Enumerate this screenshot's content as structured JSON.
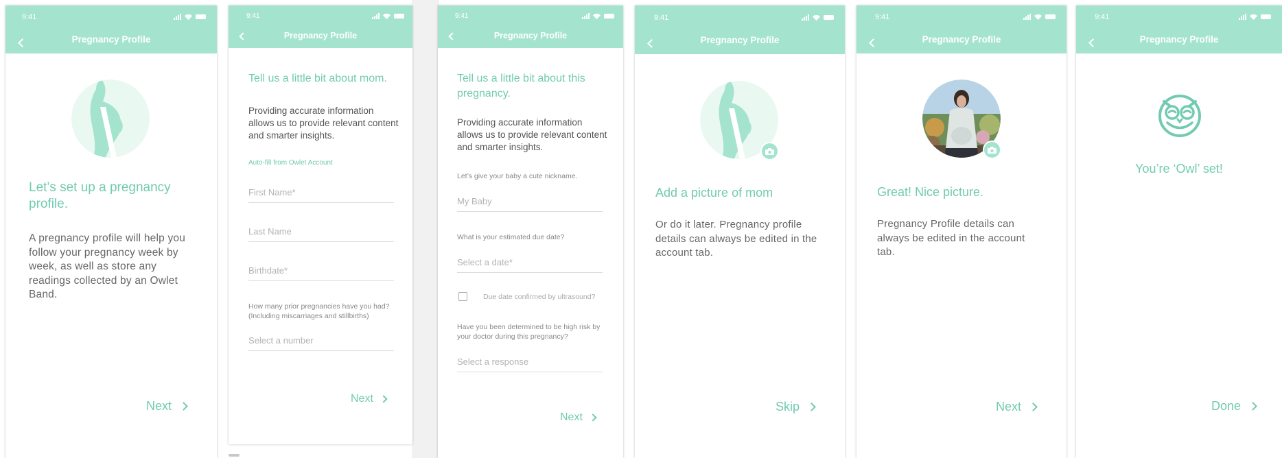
{
  "status_time": "9:41",
  "header_title": "Pregnancy Profile",
  "screen1": {
    "heading": "Let’s set up a pregnancy profile.",
    "body": "A pregnancy profile will help you follow your pregnancy week by week, as well as store any readings collected by an Owlet Band.",
    "next": "Next"
  },
  "screen2": {
    "heading": "Tell us a little bit about mom.",
    "body": "Providing accurate information allows us to provide relevant content and smarter insights.",
    "autofill": "Auto-fill from Owlet Account",
    "first_name": "First Name*",
    "last_name": "Last Name",
    "birthdate": "Birthdate*",
    "prior_question": "How many prior pregnancies have you had? (Including miscarriages and stillbirths)",
    "prior_placeholder": "Select a number",
    "next": "Next"
  },
  "screen3": {
    "heading": "Tell us a little bit about this pregnancy.",
    "body": "Providing accurate information allows us to provide relevant content and smarter insights.",
    "nickname_label": "Let’s give your baby a cute nickname.",
    "nickname_placeholder": "My Baby",
    "due_label": "What is your estimated due date?",
    "due_placeholder": "Select a date*",
    "ultrasound_label": "Due date confirmed by ultrasound?",
    "risk_label": "Have you been determined to be high risk by your doctor during this pregnancy?",
    "risk_placeholder": "Select a response",
    "next": "Next"
  },
  "screen4": {
    "heading": "Add a picture of mom",
    "body": "Or do it later.  Pregnancy profile details can always be edited in the account tab.",
    "skip": "Skip"
  },
  "screen5": {
    "heading": "Great! Nice picture.",
    "body": "Pregnancy Profile details can always be edited in the account tab.",
    "next": "Next"
  },
  "screen6": {
    "heading": "You’re ‘Owl’ set!",
    "done": "Done"
  },
  "colors": {
    "accent": "#a4e4cf",
    "accent_text": "#72cbb1",
    "avatar_bg": "#eaf8f2"
  }
}
